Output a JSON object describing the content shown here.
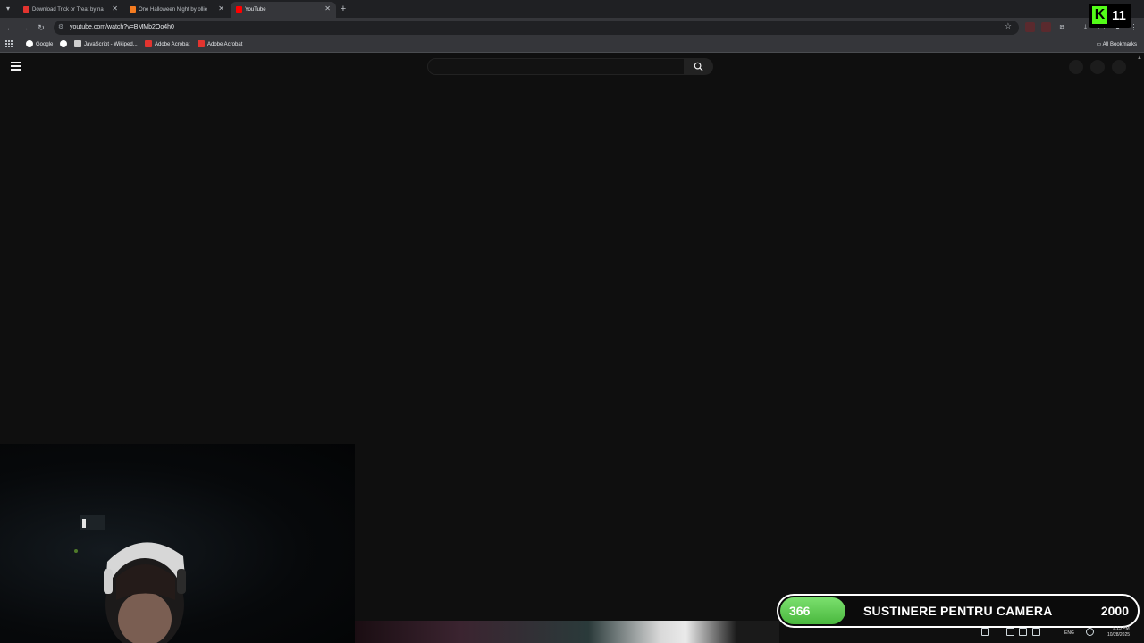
{
  "browser": {
    "tabs": [
      {
        "title": "Download Trick or Treat by na",
        "favicon_color": "#e3342f",
        "active": false
      },
      {
        "title": "One Halloween Night by ollie",
        "favicon_color": "#f47b20",
        "active": false
      },
      {
        "title": "YouTube",
        "favicon_color": "#ff0000",
        "active": true
      }
    ],
    "new_tab": "+",
    "url": "youtube.com/watch?v=BMMb2Oo4h0",
    "bookmarks": [
      {
        "label": "Google",
        "icon_color": "#ffffff"
      },
      {
        "label": "",
        "icon_color": "#ffffff"
      },
      {
        "label": "JavaScript - Wikiped...",
        "icon_color": "#cfcfcf"
      },
      {
        "label": "Adobe Acrobat",
        "icon_color": "#e3342f"
      },
      {
        "label": "Adobe Acrobat",
        "icon_color": "#e3342f"
      }
    ],
    "all_bookmarks": "All Bookmarks"
  },
  "youtube": {
    "search_placeholder": ""
  },
  "overlay": {
    "kick_letter": "K",
    "viewer_count": "11",
    "goal": {
      "current": "366",
      "label": "SUSTINERE PENTRU CAMERA",
      "target": "2000",
      "progress": 0.183,
      "color": "#53c443"
    },
    "clock": {
      "time": "9:13 PM",
      "date": "10/28/2025",
      "lang": "ENG"
    }
  }
}
